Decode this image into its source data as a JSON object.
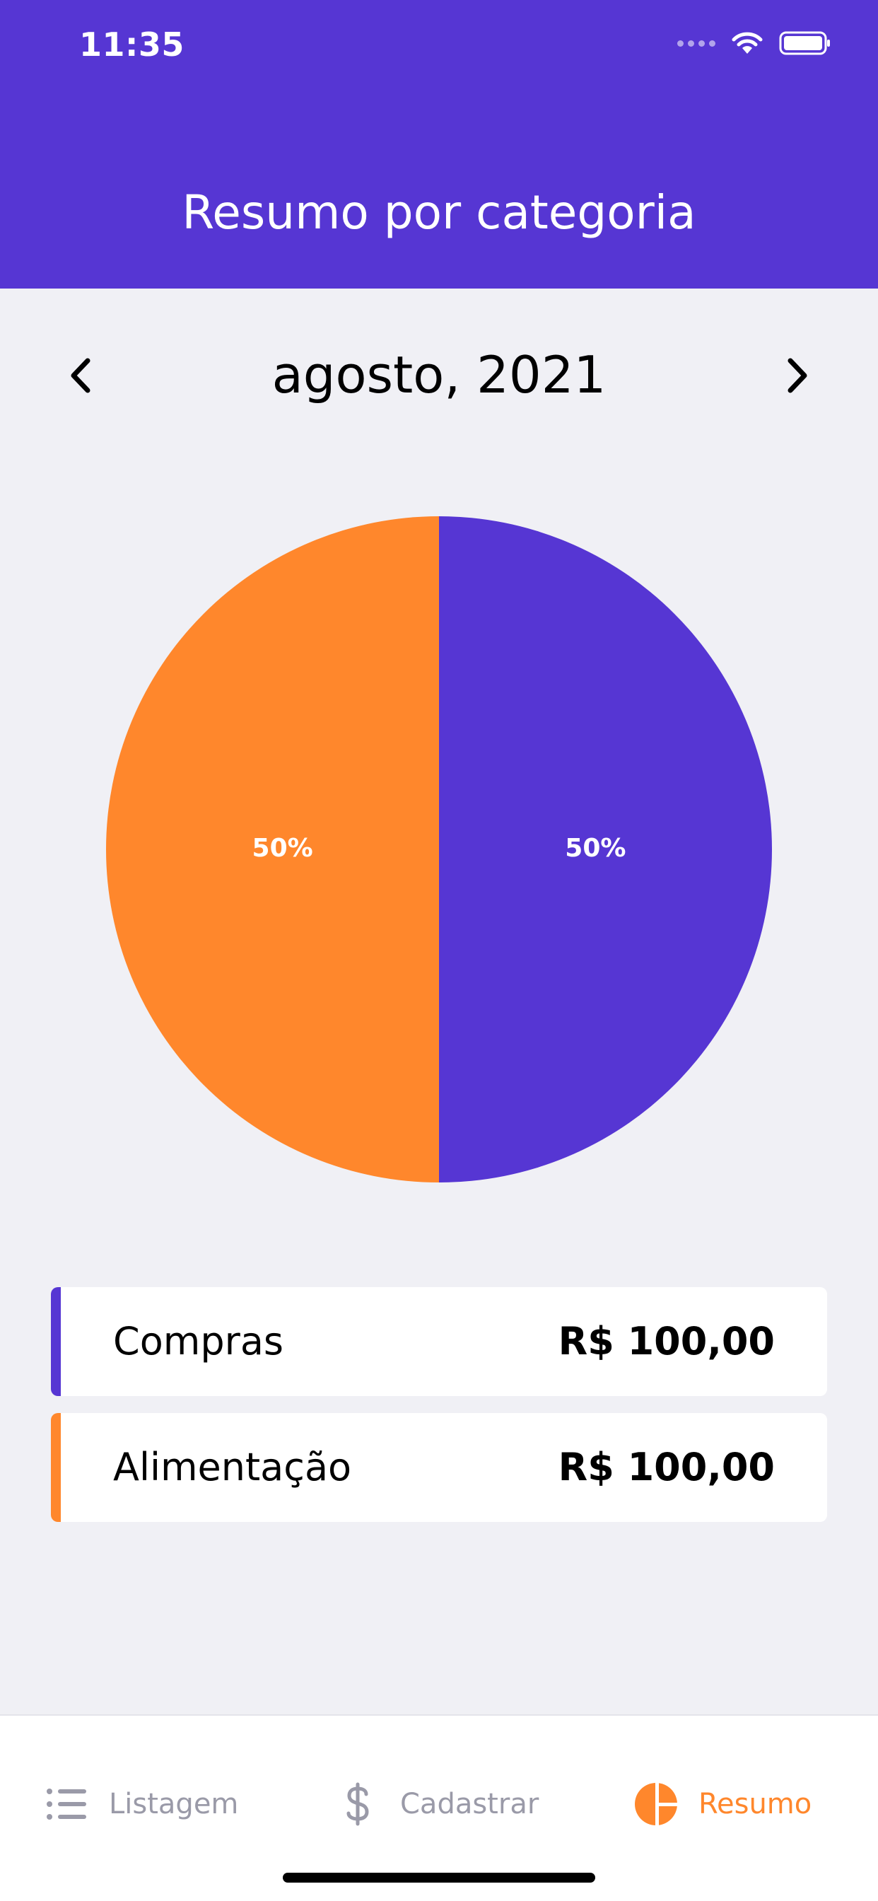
{
  "status_bar": {
    "time": "11:35"
  },
  "header": {
    "title": "Resumo por categoria"
  },
  "month_selector": {
    "label": "agosto, 2021",
    "prev_icon": "chevron-left-icon",
    "next_icon": "chevron-right-icon"
  },
  "chart_data": {
    "type": "pie",
    "slices": [
      {
        "label": "Compras",
        "value": 50,
        "display": "50%",
        "color": "#5636d3"
      },
      {
        "label": "Alimentação",
        "value": 50,
        "display": "50%",
        "color": "#ff872c"
      }
    ]
  },
  "categories": [
    {
      "name": "Compras",
      "amount": "R$ 100,00",
      "color": "#5636d3"
    },
    {
      "name": "Alimentação",
      "amount": "R$ 100,00",
      "color": "#ff872c"
    }
  ],
  "tabbar": {
    "items": [
      {
        "label": "Listagem",
        "icon": "list-icon",
        "active": false
      },
      {
        "label": "Cadastrar",
        "icon": "dollar-sign-icon",
        "active": false
      },
      {
        "label": "Resumo",
        "icon": "pie-chart-icon",
        "active": true
      }
    ]
  },
  "colors": {
    "primary": "#5636d3",
    "secondary": "#ff872c",
    "background": "#f0f0f5",
    "inactive_text": "#9a9aa8"
  }
}
